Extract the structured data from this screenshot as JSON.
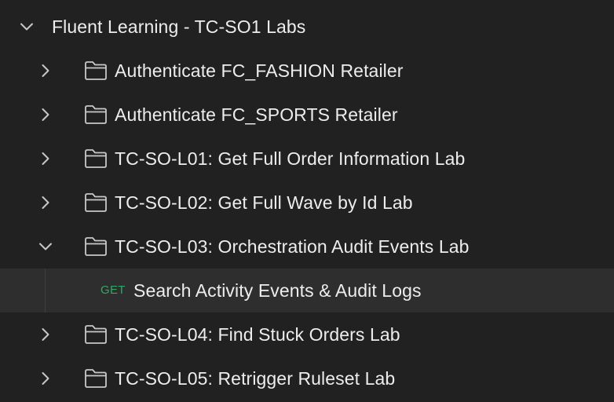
{
  "collection": {
    "name": "Fluent Learning - TC-SO1 Labs",
    "expanded": true
  },
  "folders": [
    {
      "name": "Authenticate FC_FASHION Retailer",
      "expanded": false
    },
    {
      "name": "Authenticate FC_SPORTS Retailer",
      "expanded": false
    },
    {
      "name": "TC-SO-L01: Get Full Order Information Lab",
      "expanded": false
    },
    {
      "name": "TC-SO-L02: Get Full Wave by Id Lab",
      "expanded": false
    },
    {
      "name": "TC-SO-L03: Orchestration Audit Events Lab",
      "expanded": true
    },
    {
      "name": "TC-SO-L04: Find Stuck Orders Lab",
      "expanded": false
    },
    {
      "name": "TC-SO-L05: Retrigger Ruleset Lab",
      "expanded": false
    }
  ],
  "request": {
    "method": "GET",
    "name": "Search Activity Events & Audit Logs",
    "selected": true
  },
  "icons": {
    "expand": "chevron-right-icon",
    "collapse": "chevron-down-icon",
    "folder": "folder-icon"
  },
  "colors": {
    "background": "#212121",
    "selected_row": "#2e2e2e",
    "text": "#ededed",
    "icon": "#c8c8c8",
    "get_method": "#2fa864"
  }
}
